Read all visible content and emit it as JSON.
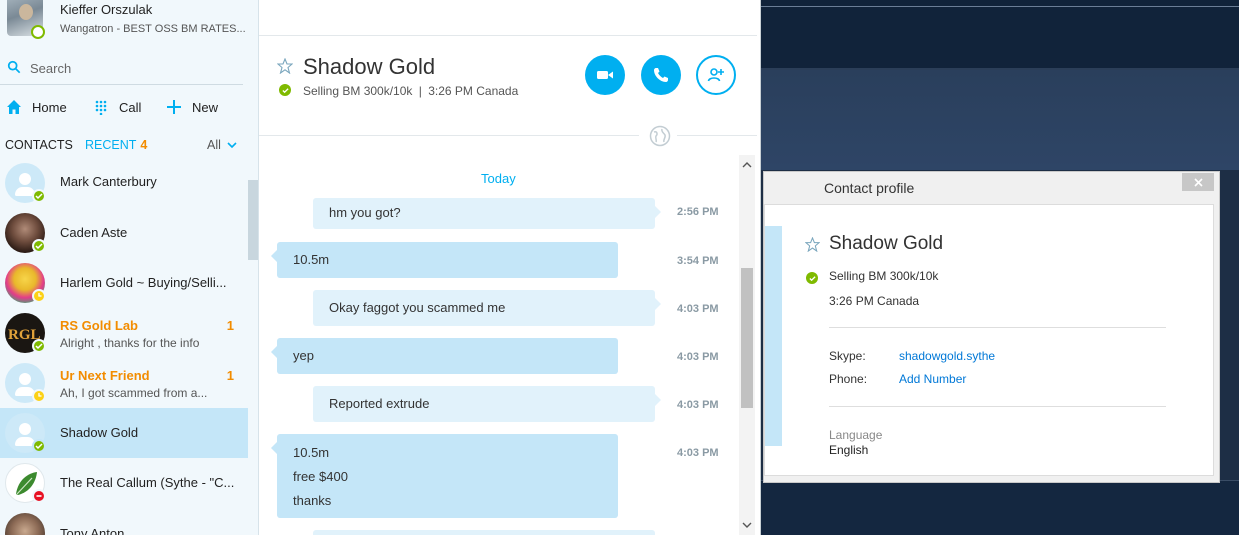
{
  "profile_me": {
    "name": "Kieffer Orszulak",
    "mood": "Wangatron - BEST OSS BM RATES..."
  },
  "search": {
    "placeholder": "Search"
  },
  "nav": {
    "home": "Home",
    "call": "Call",
    "new": "New"
  },
  "tabs": {
    "contacts": "CONTACTS",
    "recent": "RECENT",
    "recent_count": "4",
    "filter": "All"
  },
  "contacts": [
    {
      "name": "Mark Canterbury",
      "preview": "",
      "badge": "",
      "status": "online"
    },
    {
      "name": "Caden Aste",
      "preview": "",
      "badge": "",
      "status": "online"
    },
    {
      "name": "Harlem Gold ~ Buying/Selli...",
      "preview": "",
      "badge": "",
      "status": "away"
    },
    {
      "name": "RS Gold Lab",
      "preview": "Alright , thanks for the info",
      "badge": "1",
      "status": "online"
    },
    {
      "name": "Ur Next Friend",
      "preview": "Ah, I got scammed from a...",
      "badge": "1",
      "status": "away"
    },
    {
      "name": "Shadow Gold",
      "preview": "",
      "badge": "",
      "status": "online"
    },
    {
      "name": "The Real Callum (Sythe - \"C...",
      "preview": "",
      "badge": "",
      "status": "busy"
    },
    {
      "name": "Tony Anton",
      "preview": "",
      "badge": "",
      "status": "online"
    }
  ],
  "conversation": {
    "title": "Shadow Gold",
    "mood": "Selling BM 300k/10k",
    "separator": "|",
    "local_time": "3:26 PM Canada",
    "date_label": "Today",
    "messages": [
      {
        "direction": "out",
        "lines": [
          "hm you got?"
        ],
        "time": "2:56 PM"
      },
      {
        "direction": "in",
        "lines": [
          "10.5m"
        ],
        "time": "3:54 PM"
      },
      {
        "direction": "out",
        "lines": [
          "Okay faggot you scammed me"
        ],
        "time": "4:03 PM"
      },
      {
        "direction": "in",
        "lines": [
          "yep"
        ],
        "time": "4:03 PM"
      },
      {
        "direction": "out",
        "lines": [
          "Reported extrude"
        ],
        "time": "4:03 PM"
      },
      {
        "direction": "in",
        "lines": [
          "10.5m",
          "free $400",
          "thanks"
        ],
        "time": "4:03 PM"
      }
    ]
  },
  "contact_profile": {
    "window_title": "Contact profile",
    "name": "Shadow Gold",
    "mood": "Selling BM 300k/10k",
    "local_time": "3:26 PM Canada",
    "skype_label": "Skype:",
    "skype_value": "shadowgold.sythe",
    "phone_label": "Phone:",
    "phone_value": "Add Number",
    "language_label": "Language",
    "language_value": "English"
  },
  "colors": {
    "accent": "#00aff0",
    "unread": "#f28c00",
    "online": "#7fba00",
    "away": "#fcd116",
    "busy": "#e81123",
    "bubble_in": "#c4e6f8",
    "bubble_out": "#e1f2fb"
  },
  "icons": [
    "search-icon",
    "home-icon",
    "dialpad-icon",
    "plus-icon",
    "chevron-down-icon",
    "star-icon",
    "video-call-icon",
    "phone-icon",
    "add-person-icon",
    "globe-icon",
    "close-icon",
    "check-icon"
  ]
}
